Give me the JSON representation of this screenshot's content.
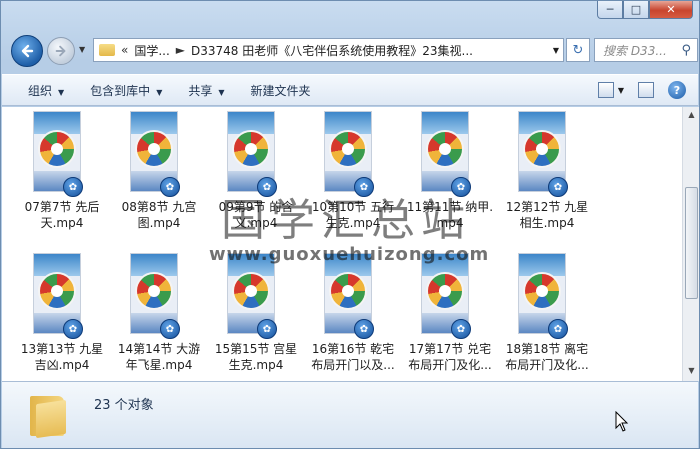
{
  "address": {
    "overflow": "«",
    "crumbs": [
      "国学...",
      "D33748 田老师《八宅伴侣系统使用教程》23集视..."
    ]
  },
  "search": {
    "placeholder": "搜索 D33..."
  },
  "toolbar": {
    "organize": "组织",
    "include_library": "包含到库中",
    "share": "共享",
    "new_folder": "新建文件夹"
  },
  "files": [
    {
      "line1": "07第7节 先后",
      "line2": "天.mp4"
    },
    {
      "line1": "08第8节 九宫",
      "line2": "图.mp4"
    },
    {
      "line1": "09第9节 的含",
      "line2": "义.mp4"
    },
    {
      "line1": "10第10节 五行",
      "line2": "生克.mp4"
    },
    {
      "line1": "11第11节 纳甲.",
      "line2": "mp4"
    },
    {
      "line1": "12第12节 九星",
      "line2": "相生.mp4"
    },
    {
      "line1": "13第13节 九星",
      "line2": "吉凶.mp4"
    },
    {
      "line1": "14第14节 大游",
      "line2": "年飞星.mp4"
    },
    {
      "line1": "15第15节 宫星",
      "line2": "生克.mp4"
    },
    {
      "line1": "16第16节 乾宅",
      "line2": "布局开门以及..."
    },
    {
      "line1": "17第17节 兑宅",
      "line2": "布局开门及化..."
    },
    {
      "line1": "18第18节 离宅",
      "line2": "布局开门及化..."
    }
  ],
  "watermark": {
    "text": "国学汇总站",
    "url": "www.guoxuehuizong.com"
  },
  "status": {
    "count": "23 个对象"
  },
  "colors": {
    "accent": "#1f5fa8",
    "close": "#c8452e"
  }
}
